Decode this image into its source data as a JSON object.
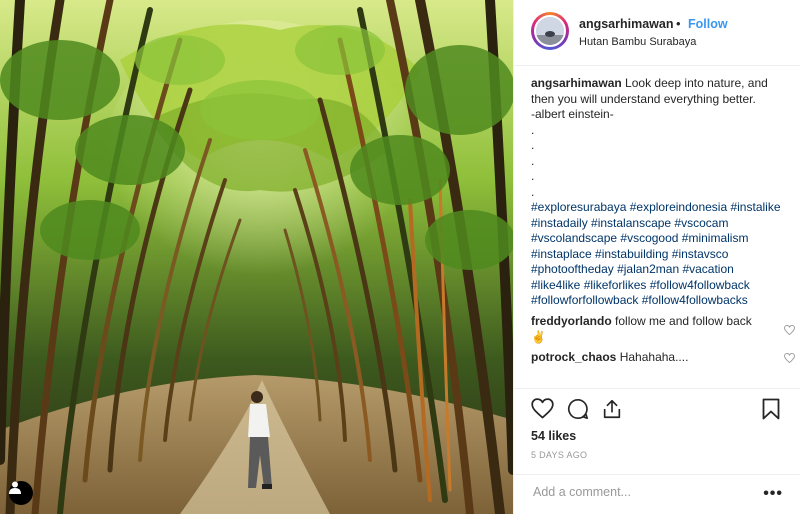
{
  "header": {
    "username": "angsarhimawan",
    "separator": "•",
    "follow_label": "Follow",
    "location": "Hutan Bambu Surabaya"
  },
  "caption": {
    "username": "angsarhimawan",
    "line1": "Look deep into nature, and",
    "line2": "then you will understand everything better.",
    "line3": "-albert einstein-",
    "dots": [
      ".",
      ".",
      ".",
      ".",
      "."
    ],
    "hashtag_lines": [
      "#exploresurabaya #exploreindonesia #instalike",
      "#instadaily #instalanscape #vscocam",
      "#vscolandscape #vscogood #minimalism",
      "#instaplace #instabuilding #instavsco",
      "#photooftheday #jalan2man #vacation",
      "#like4like #likeforlikes #follow4followback",
      "#followforfollowback #follow4followbacks"
    ]
  },
  "comments": [
    {
      "username": "freddyorlando",
      "text": "follow me and follow back",
      "emoji": "✌️"
    },
    {
      "username": "potrock_chaos",
      "text": "Hahahaha...."
    }
  ],
  "actions": {
    "likes": "54 likes",
    "date": "5 DAYS AGO"
  },
  "comment_box": {
    "placeholder": "Add a comment...",
    "more_label": "•••"
  },
  "icons": [
    "heart-icon",
    "comment-icon",
    "share-icon",
    "bookmark-icon",
    "user-tag-icon",
    "comment-like-icon"
  ],
  "colors": {
    "link": "#3897f0",
    "hashtag": "#003569",
    "muted": "#999999",
    "border": "#efefef"
  }
}
